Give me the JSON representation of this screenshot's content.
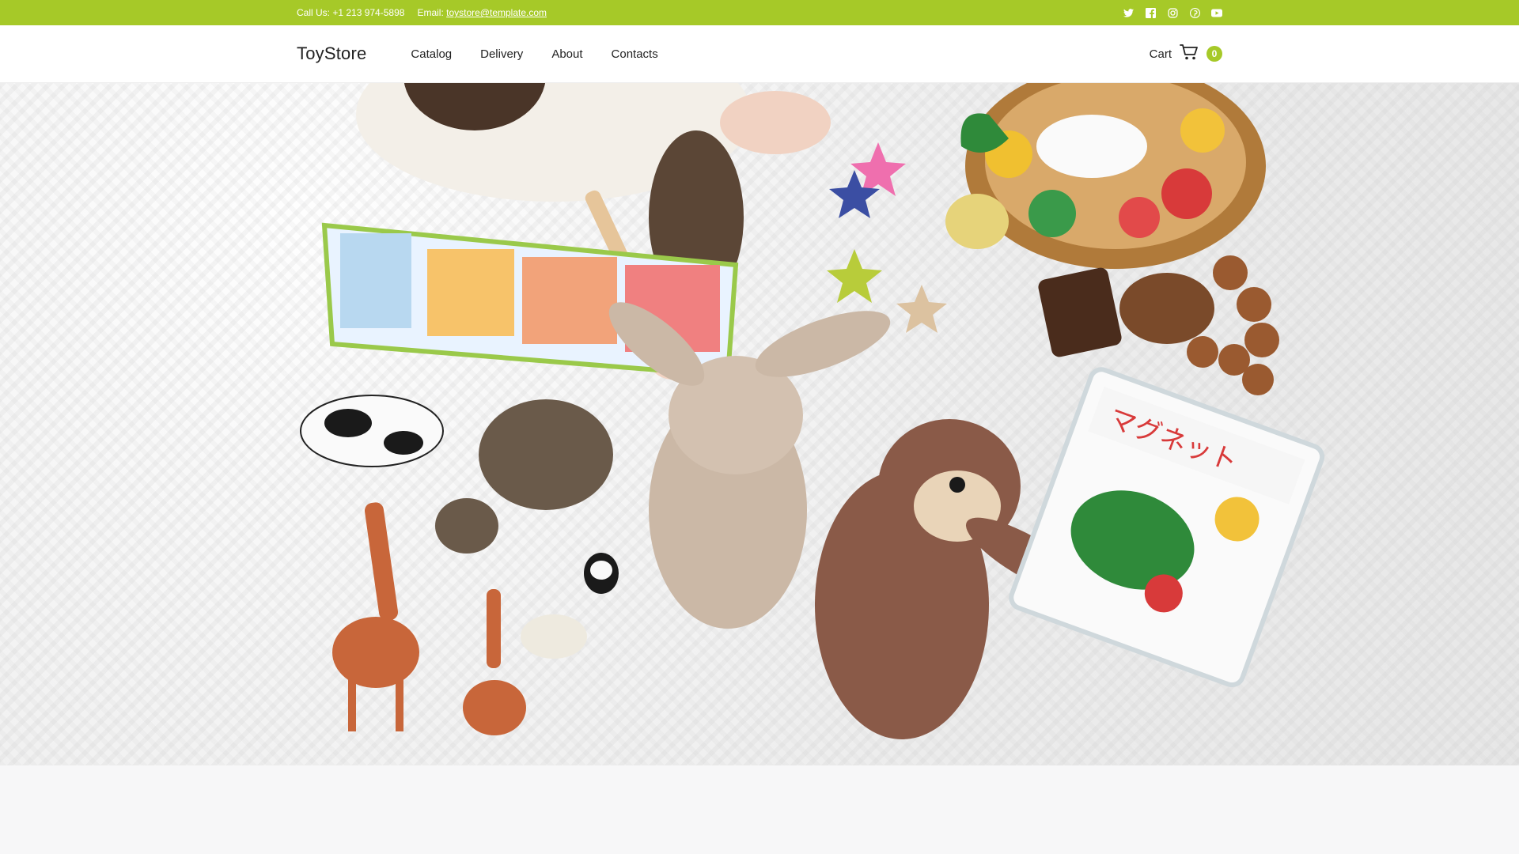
{
  "topbar": {
    "call_label": "Call Us: +1 213 974-5898",
    "email_prefix": "Email:",
    "email_link": "toystore@template.com",
    "social_icons": [
      "twitter-icon",
      "facebook-icon",
      "instagram-icon",
      "pinterest-icon",
      "youtube-icon"
    ]
  },
  "header": {
    "logo": "ToyStore",
    "nav": [
      "Catalog",
      "Delivery",
      "About",
      "Contacts"
    ],
    "cart_label": "Cart",
    "cart_count": "0"
  },
  "colors": {
    "accent": "#a6c928",
    "text": "#222222",
    "bg": "#f7f7f8"
  }
}
